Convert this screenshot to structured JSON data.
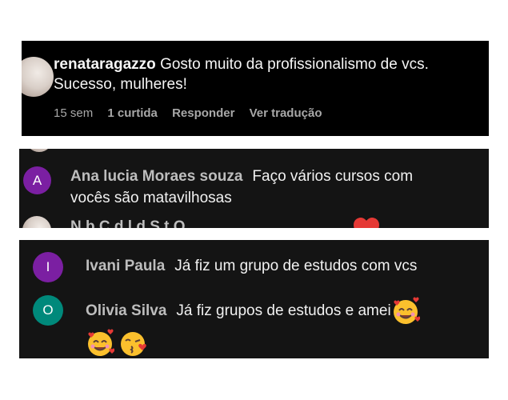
{
  "panel1": {
    "username": "renataragazzo",
    "text": "Gosto muito da profissionalismo de vcs. Sucesso, mulheres!",
    "time": "15 sem",
    "likes": "1 curtida",
    "reply": "Responder",
    "translate": "Ver tradução"
  },
  "panel2": {
    "avatar_letter": "A",
    "username": "Ana lucia Moraes souza",
    "text": "Faço vários cursos com vocês são matavilhosas",
    "peek_text": "N b   C  d  l    d    S   t  Q"
  },
  "panel3": {
    "messages": [
      {
        "avatar_letter": "I",
        "username": "Ivani Paula",
        "text": "Já fiz um grupo de estudos com vcs"
      },
      {
        "avatar_letter": "O",
        "username": "Olivia Silva",
        "text": "Já fiz grupos de estudos e amei"
      }
    ]
  },
  "colors": {
    "avatar_purple": "#7b1fa2",
    "avatar_teal": "#00897b",
    "chat_bg": "#141414",
    "ig_bg": "#000000"
  },
  "icons": [
    "smiling-face-with-hearts-icon",
    "face-blowing-kiss-icon",
    "red-heart-icon"
  ]
}
